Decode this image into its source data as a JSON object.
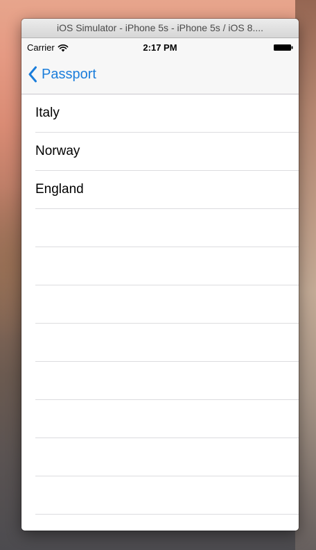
{
  "simulator": {
    "title": "iOS Simulator - iPhone 5s - iPhone 5s / iOS 8...."
  },
  "status_bar": {
    "carrier": "Carrier",
    "time": "2:17 PM",
    "wifi_icon": "wifi-icon",
    "battery_icon": "battery-full-icon"
  },
  "nav": {
    "back_label": "Passport",
    "back_icon": "chevron-left-icon",
    "accent_color": "#1a7ddb"
  },
  "countries": [
    {
      "label": "Italy"
    },
    {
      "label": "Norway"
    },
    {
      "label": "England"
    }
  ]
}
